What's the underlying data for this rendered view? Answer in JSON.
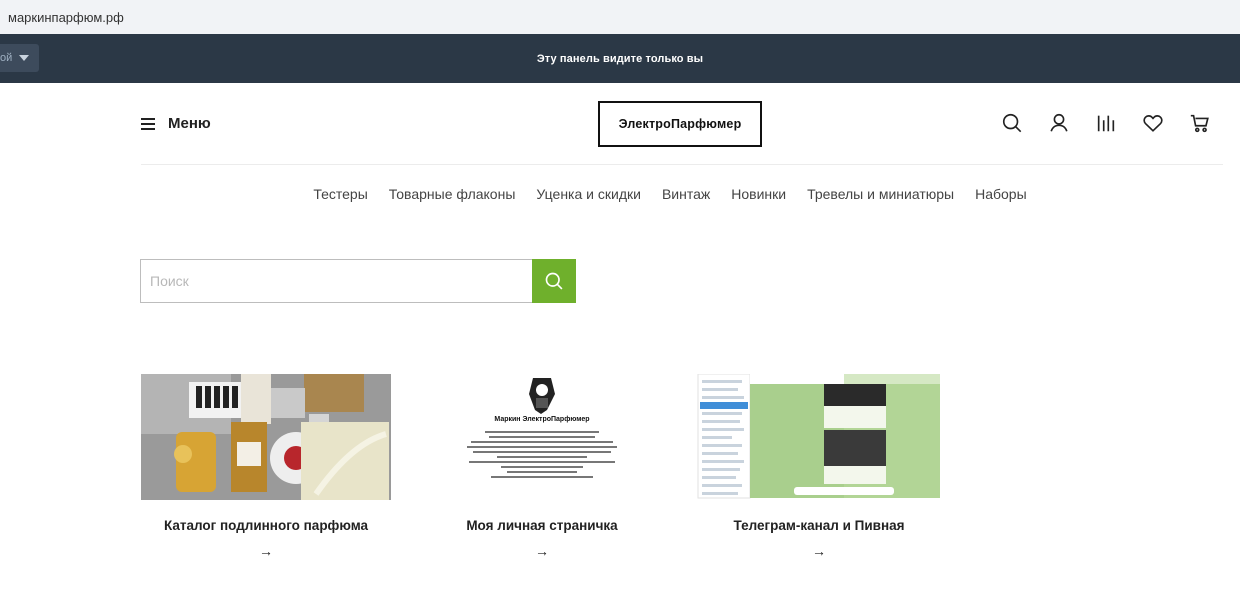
{
  "browser": {
    "url": "маркинпарфюм.рф"
  },
  "admin_bar": {
    "select_text": "ой",
    "note": "Эту панель видите только вы"
  },
  "header": {
    "menu_label": "Меню",
    "logo_text": "ЭлектроПарфюмер",
    "icons": [
      "search-icon",
      "user-icon",
      "compare-icon",
      "heart-icon",
      "cart-icon"
    ]
  },
  "nav": {
    "items": [
      "Тестеры",
      "Товарные флаконы",
      "Уценка и скидки",
      "Винтаж",
      "Новинки",
      "Тревелы и миниатюры",
      "Наборы"
    ]
  },
  "search": {
    "placeholder": "Поиск",
    "value": "",
    "button_color": "#6fb02c"
  },
  "cards": [
    {
      "title": "Каталог подлинного парфюма",
      "arrow": "→"
    },
    {
      "title": "Моя личная страничка",
      "arrow": "→",
      "image_heading": "Маркин ЭлектроПарфюмер"
    },
    {
      "title": "Телеграм-канал и Пивная",
      "arrow": "→"
    }
  ],
  "colors": {
    "admin_bar": "#2b3846",
    "accent": "#6fb02c"
  }
}
